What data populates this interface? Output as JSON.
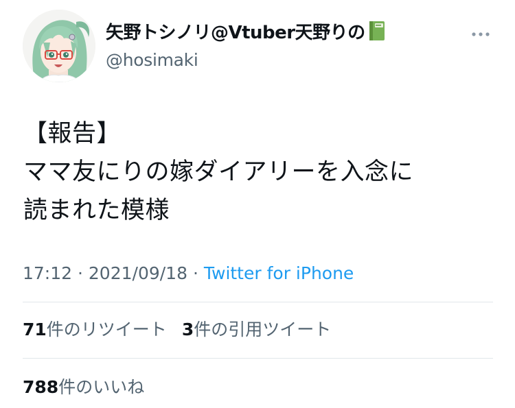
{
  "tweet": {
    "display_name": "矢野トシノリ@Vtuber天野りの",
    "display_name_emoji_icon": "green-book-icon",
    "handle": "@hosimaki",
    "body_lines": [
      "【報告】",
      "ママ友にりの嫁ダイアリーを入念に",
      "読まれた模様"
    ],
    "time": "17:12",
    "separator": "·",
    "date": "2021/09/18",
    "source": "Twitter for iPhone"
  },
  "stats": {
    "retweets_count": "71",
    "retweets_label": "件のリツイート",
    "quotes_count": "3",
    "quotes_label": "件の引用ツイート",
    "likes_count": "788",
    "likes_label": "件のいいね"
  },
  "colors": {
    "text": "#0f1419",
    "secondary": "#536471",
    "link": "#1d9bf0",
    "divider": "#e1e6ea"
  }
}
